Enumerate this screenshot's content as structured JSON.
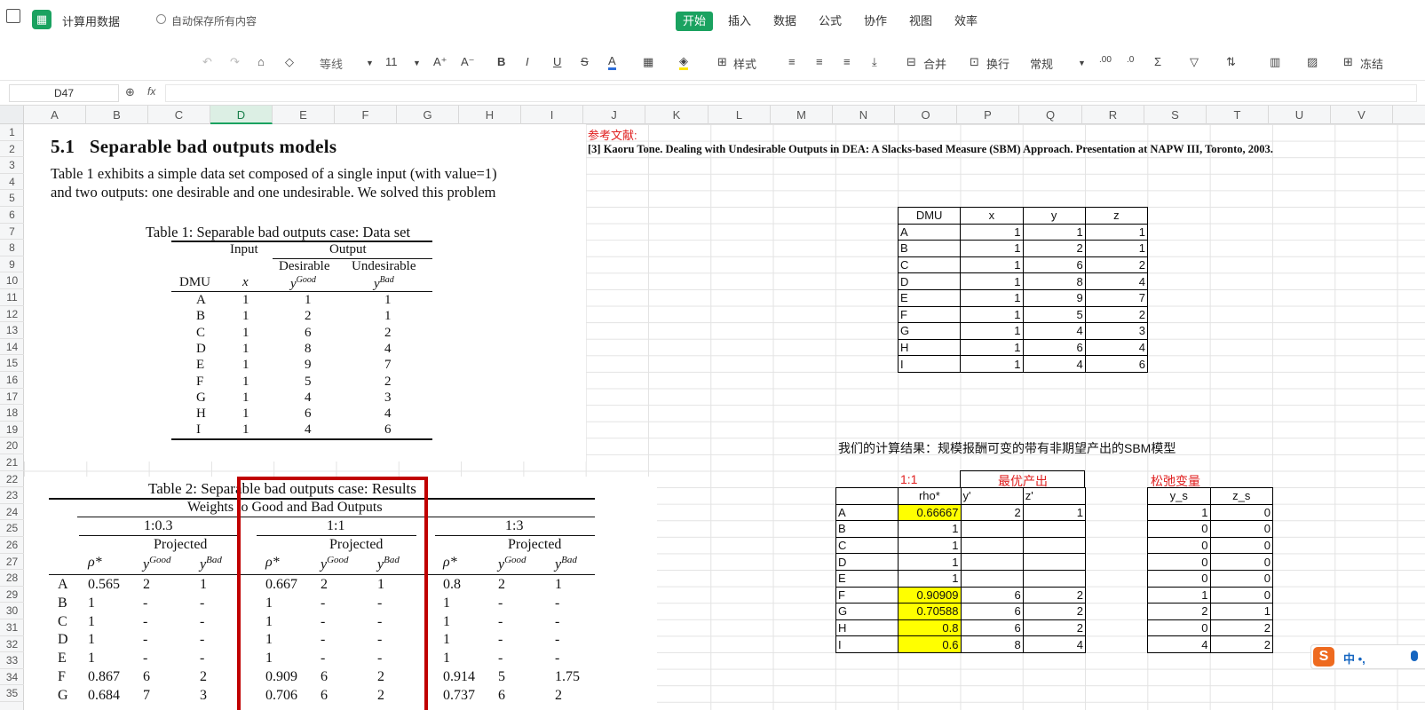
{
  "app": {
    "doc_title": "计算用数据",
    "autosave": "自动保存所有内容"
  },
  "tabs": [
    "开始",
    "插入",
    "数据",
    "公式",
    "协作",
    "视图",
    "效率"
  ],
  "toolbar": {
    "font": "等线",
    "size": "11",
    "style_btn": "样式",
    "merge": "合并",
    "wrap": "换行",
    "format": "常规",
    "freeze": "冻结"
  },
  "formula": {
    "cell_ref": "D47",
    "fx": "fx",
    "value": ""
  },
  "columns": [
    "A",
    "B",
    "C",
    "D",
    "E",
    "F",
    "G",
    "H",
    "I",
    "J",
    "K",
    "L",
    "M",
    "N",
    "O",
    "P",
    "Q",
    "R",
    "S",
    "T",
    "U",
    "V"
  ],
  "rows": [
    "1",
    "2",
    "3",
    "4",
    "5",
    "6",
    "7",
    "8",
    "9",
    "10",
    "11",
    "12",
    "13",
    "14",
    "15",
    "16",
    "17",
    "18",
    "19",
    "20",
    "21",
    "22",
    "23",
    "24",
    "25",
    "26",
    "27",
    "28",
    "29",
    "30",
    "31",
    "32",
    "33",
    "34",
    "35"
  ],
  "paper1": {
    "heading_num": "5.1",
    "heading": "Separable bad outputs models",
    "line1": "Table 1 exhibits a simple data set composed of a single input (with value=1)",
    "line2": "and two outputs:  one desirable and one undesirable.  We solved this problem",
    "table_caption": "Table 1: Separable bad outputs case: Data set",
    "hdr_input": "Input",
    "hdr_output": "Output",
    "hdr_desirable": "Desirable",
    "hdr_undesirable": "Undesirable",
    "col_dmu": "DMU",
    "col_x": "x",
    "col_yg": "y",
    "col_yg_sup": "Good",
    "col_yb": "y",
    "col_yb_sup": "Bad",
    "rows": [
      [
        "A",
        "1",
        "1",
        "1"
      ],
      [
        "B",
        "1",
        "2",
        "1"
      ],
      [
        "C",
        "1",
        "6",
        "2"
      ],
      [
        "D",
        "1",
        "8",
        "4"
      ],
      [
        "E",
        "1",
        "9",
        "7"
      ],
      [
        "F",
        "1",
        "5",
        "2"
      ],
      [
        "G",
        "1",
        "4",
        "3"
      ],
      [
        "H",
        "1",
        "6",
        "4"
      ],
      [
        "I",
        "1",
        "4",
        "6"
      ]
    ]
  },
  "paper2": {
    "caption": "Table 2: Separable bad outputs case: Results",
    "sub": "Weights to Good and Bad Outputs",
    "groups": [
      "1:0.3",
      "1:1",
      "1:3"
    ],
    "projected": "Projected",
    "rho": "ρ*",
    "yg": "y",
    "yg_sup": "Good",
    "yb": "y",
    "yb_sup": "Bad",
    "rows": [
      [
        "A",
        "0.565",
        "2",
        "1",
        "0.667",
        "2",
        "1",
        "0.8",
        "2",
        "1"
      ],
      [
        "B",
        "1",
        "-",
        "-",
        "1",
        "-",
        "-",
        "1",
        "-",
        "-"
      ],
      [
        "C",
        "1",
        "-",
        "-",
        "1",
        "-",
        "-",
        "1",
        "-",
        "-"
      ],
      [
        "D",
        "1",
        "-",
        "-",
        "1",
        "-",
        "-",
        "1",
        "-",
        "-"
      ],
      [
        "E",
        "1",
        "-",
        "-",
        "1",
        "-",
        "-",
        "1",
        "-",
        "-"
      ],
      [
        "F",
        "0.867",
        "6",
        "2",
        "0.909",
        "6",
        "2",
        "0.914",
        "5",
        "1.75"
      ],
      [
        "G",
        "0.684",
        "7",
        "3",
        "0.706",
        "6",
        "2",
        "0.737",
        "6",
        "2"
      ]
    ]
  },
  "ref": {
    "label": "参考文献:",
    "text": "[3] Kaoru Tone. Dealing with Undesirable Outputs in DEA: A Slacks-based Measure (SBM) Approach. Presentation at NAPW III, Toronto, 2003."
  },
  "data_table": {
    "headers": [
      "DMU",
      "x",
      "y",
      "z"
    ],
    "rows": [
      [
        "A",
        "1",
        "1",
        "1"
      ],
      [
        "B",
        "1",
        "2",
        "1"
      ],
      [
        "C",
        "1",
        "6",
        "2"
      ],
      [
        "D",
        "1",
        "8",
        "4"
      ],
      [
        "E",
        "1",
        "9",
        "7"
      ],
      [
        "F",
        "1",
        "5",
        "2"
      ],
      [
        "G",
        "1",
        "4",
        "3"
      ],
      [
        "H",
        "1",
        "6",
        "4"
      ],
      [
        "I",
        "1",
        "4",
        "6"
      ]
    ]
  },
  "results": {
    "title": "我们的计算结果：规模报酬可变的带有非期望产出的SBM模型",
    "ratio": "1:1",
    "optimal": "最优产出",
    "slack": "松弛变量",
    "h_rho": "rho*",
    "h_y": "y'",
    "h_z": "z'",
    "h_ys": "y_s",
    "h_zs": "z_s",
    "rows": [
      [
        "A",
        "0.66667",
        "2",
        "1",
        "1",
        "0"
      ],
      [
        "B",
        "1",
        "",
        "",
        "0",
        "0"
      ],
      [
        "C",
        "1",
        "",
        "",
        "0",
        "0"
      ],
      [
        "D",
        "1",
        "",
        "",
        "0",
        "0"
      ],
      [
        "E",
        "1",
        "",
        "",
        "0",
        "0"
      ],
      [
        "F",
        "0.90909",
        "6",
        "2",
        "1",
        "0"
      ],
      [
        "G",
        "0.70588",
        "6",
        "2",
        "2",
        "1"
      ],
      [
        "H",
        "0.8",
        "6",
        "2",
        "0",
        "2"
      ],
      [
        "I",
        "0.6",
        "8",
        "4",
        "4",
        "2"
      ]
    ],
    "highlight": [
      "A",
      "F",
      "G",
      "H",
      "I"
    ],
    "highlight_color": "#ffff00"
  },
  "ime": {
    "logo": "S",
    "text": "中 •,"
  },
  "colors": {
    "accent": "#1aa260",
    "red": "#e02020",
    "box": "#c00000"
  }
}
